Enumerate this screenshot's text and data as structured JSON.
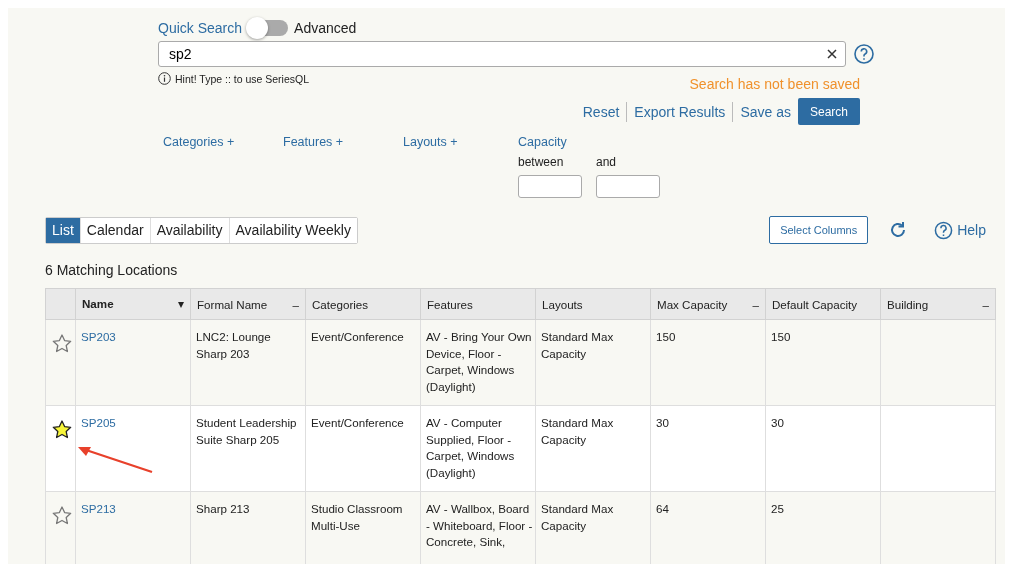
{
  "search": {
    "quick_label": "Quick Search",
    "advanced_label": "Advanced",
    "advanced": false,
    "value": "sp2",
    "hint": "Hint! Type :: to use SeriesQL",
    "save_status": "Search has not been saved"
  },
  "actions": [
    "Reset",
    "Export Results",
    "Save as"
  ],
  "search_button": "Search",
  "filters": [
    "Categories +",
    "Features +",
    "Layouts +"
  ],
  "capacity": {
    "label": "Capacity",
    "from_label": "between",
    "to_label": "and"
  },
  "tabs": [
    {
      "label": "List",
      "selected": true
    },
    {
      "label": "Calendar",
      "selected": false
    },
    {
      "label": "Availability",
      "selected": false
    },
    {
      "label": "Availability Weekly",
      "selected": false
    }
  ],
  "select_columns": "Select Columns",
  "help": "Help",
  "result_count": "6 Matching Locations",
  "table": {
    "columns": [
      {
        "label": "Name",
        "control": "▾",
        "bold": true
      },
      {
        "label": "Formal Name",
        "control": "–",
        "bold": false
      },
      {
        "label": "Categories",
        "bold": false
      },
      {
        "label": "Features",
        "bold": false
      },
      {
        "label": "Layouts",
        "bold": false
      },
      {
        "label": "Max Capacity",
        "control": "–",
        "bold": false
      },
      {
        "label": "Default Capacity",
        "bold": false
      },
      {
        "label": "Building",
        "control": "–",
        "bold": false
      }
    ],
    "rows": [
      {
        "starred": false,
        "highlighted": false,
        "cells": [
          "SP203",
          "LNC2: Lounge Sharp 203",
          "Event/Conference",
          "AV - Bring Your Own Device, Floor - Carpet, Windows (Daylight)",
          "Standard Max Capacity",
          "150",
          "150",
          ""
        ]
      },
      {
        "starred": true,
        "highlighted": true,
        "cells": [
          "SP205",
          "Student Leadership Suite Sharp 205",
          "Event/Conference",
          "AV - Computer Supplied, Floor - Carpet, Windows (Daylight)",
          "Standard Max Capacity",
          "30",
          "30",
          ""
        ]
      },
      {
        "starred": false,
        "highlighted": false,
        "cells": [
          "SP213",
          "Sharp 213",
          "Studio Classroom Multi-Use",
          "AV - Wallbox, Board - Whiteboard, Floor - Concrete, Sink,",
          "Standard Max Capacity",
          "64",
          "25",
          ""
        ]
      }
    ]
  }
}
